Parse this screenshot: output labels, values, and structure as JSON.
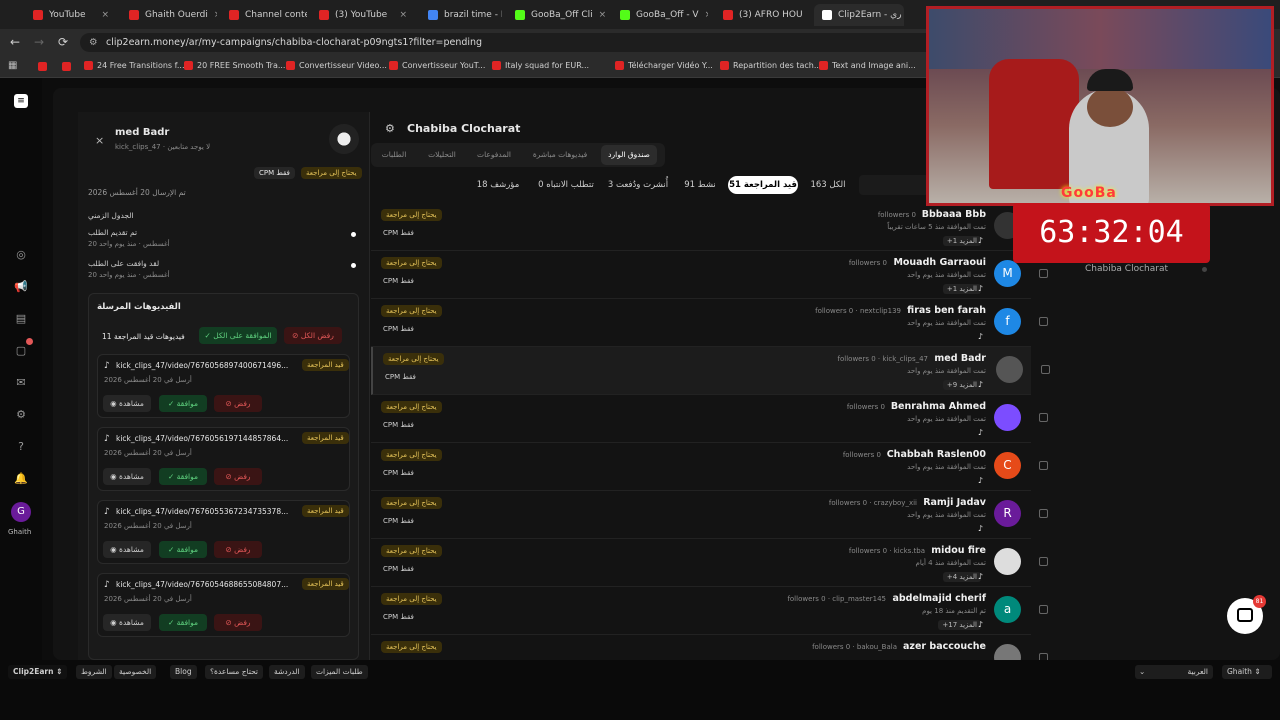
{
  "tabs": [
    {
      "title": "YouTube",
      "color": "#e02424"
    },
    {
      "title": "Ghaith Ouerdi",
      "color": "#e02424"
    },
    {
      "title": "Channel conte",
      "color": "#e02424"
    },
    {
      "title": "(3) YouTube",
      "color": "#e02424"
    },
    {
      "title": "brazil time - R",
      "color": "#4285f4"
    },
    {
      "title": "GooBa_Off Cli",
      "color": "#53fc18"
    },
    {
      "title": "GooBa_Off - V",
      "color": "#53fc18"
    },
    {
      "title": "(3) AFRO HOU",
      "color": "#e02424"
    },
    {
      "title": "Clip2Earn - ري",
      "color": "#ffffff"
    }
  ],
  "url": "clip2earn.money/ar/my-campaigns/chabiba-clocharat-p09ngts1?filter=pending",
  "bookmarks": [
    "24 Free Transitions f...",
    "20 FREE Smooth Tra...",
    "Convertisseur Video...",
    "Convertisseur YouT...",
    "Italy squad for EUR...",
    "Télécharger Vidéo Y...",
    "Repartition des tach...",
    "Text and Image ani..."
  ],
  "rail_user": "Ghaith",
  "rail_user_initial": "G",
  "left_panel": {
    "user": "med Badr",
    "subtitle": "kick_clips_47 · لا يوجد متابعين",
    "close": "×",
    "badge_review": "يحتاج إلى مراجعة",
    "badge_cpm": "CPM فقط",
    "sent_date": "تم الإرسال 20 أغسطس 2026",
    "timeline_title": "الجدول الزمني",
    "timeline": [
      {
        "title": "تم تقديم الطلب",
        "time": "20 أغسطس · منذ يوم واحد"
      },
      {
        "title": "لقد وافقت على الطلب",
        "time": "20 أغسطس · منذ يوم واحد"
      }
    ],
    "videos_title": "الفيديوهات المرسلة",
    "pending_count": "11 فيديوهات قيد المراجعة",
    "approve_all": "الموافقة على الكل",
    "reject_all": "رفض الكل",
    "videos": [
      {
        "url": "kick_clips_47/video/7676056897400671496...",
        "status": "قيد المراجعة",
        "date": "أرسل في 20 أغسطس 2026"
      },
      {
        "url": "kick_clips_47/video/7676056197144857864...",
        "status": "قيد المراجعة",
        "date": "أرسل في 20 أغسطس 2026"
      },
      {
        "url": "kick_clips_47/video/7676055367234735378...",
        "status": "قيد المراجعة",
        "date": "أرسل في 20 أغسطس 2026"
      },
      {
        "url": "kick_clips_47/video/7676054688655084807...",
        "status": "قيد المراجعة",
        "date": "أرسل في 20 أغسطس 2026"
      }
    ],
    "view": "مشاهدة",
    "approve": "موافقة",
    "reject": "رفض"
  },
  "campaign_title": "Chabiba Clocharat",
  "top_tabs": [
    "صندوق الوارد",
    "فيديوهات مباشرة",
    "المدفوعات",
    "التحليلات",
    "الطلبات"
  ],
  "filters": [
    {
      "label": "الكل 163"
    },
    {
      "label": "قيد المراجعة 51",
      "active": true
    },
    {
      "label": "نشط 91"
    },
    {
      "label": "أُنشرت ودُفعت 3"
    },
    {
      "label": "تتطلب الانتباه 0"
    },
    {
      "label": "مؤرشف 18"
    }
  ],
  "rows": [
    {
      "name": "Bbbaaa Bbb",
      "sub": "followers 0",
      "meta": "تمت الموافقة منذ 5 ساعات تقريباً",
      "more": "+1 المزيد",
      "avatar": "",
      "color": "#333"
    },
    {
      "name": "Mouadh Garraoui",
      "sub": "followers 0",
      "meta": "تمت الموافقة منذ يوم واحد",
      "more": "+1 المزيد",
      "avatar": "M",
      "color": "#1e88e5"
    },
    {
      "name": "firas ben farah",
      "sub": "followers 0 · nextclip139",
      "meta": "تمت الموافقة منذ يوم واحد",
      "more": "",
      "avatar": "f",
      "color": "#1e88e5"
    },
    {
      "name": "med Badr",
      "sub": "followers 0 · kick_clips_47",
      "meta": "تمت الموافقة منذ يوم واحد",
      "more": "+9 المزيد",
      "avatar": "",
      "color": "#555"
    },
    {
      "name": "Benrahma Ahmed",
      "sub": "followers 0",
      "meta": "تمت الموافقة منذ يوم واحد",
      "more": "",
      "avatar": "",
      "color": "#7c4dff"
    },
    {
      "name": "Chabbah Raslen00",
      "sub": "followers 0",
      "meta": "تمت الموافقة منذ يوم واحد",
      "more": "",
      "avatar": "C",
      "color": "#e64a19"
    },
    {
      "name": "Ramji Jadav",
      "sub": "followers 0 · crazyboy_xii",
      "meta": "تمت الموافقة منذ يوم واحد",
      "more": "",
      "avatar": "R",
      "color": "#6a1b9a"
    },
    {
      "name": "midou fire",
      "sub": "followers 0 · kicks.tba",
      "meta": "تمت الموافقة منذ 4 أيام",
      "more": "+4 المزيد",
      "avatar": "",
      "color": "#ddd"
    },
    {
      "name": "abdelmajid cherif",
      "sub": "followers 0 · clip_master145",
      "meta": "تم التقديم منذ 18 يوم",
      "more": "+17 المزيد",
      "avatar": "a",
      "color": "#00897b"
    },
    {
      "name": "azer baccouche",
      "sub": "followers 0 · bakou_Bala",
      "meta": "",
      "more": "",
      "avatar": "",
      "color": "#777"
    }
  ],
  "row_badge": "يحتاج إلى مراجعة",
  "row_cpm": "CPM فقط",
  "right_campaign": "Chabiba Clocharat",
  "timer": "63:32:04",
  "overlay_name": "GooBa",
  "bottom_bar": {
    "brand": "Clip2Earn",
    "links": [
      "الشروط",
      "الخصوصية",
      "Blog",
      "تحتاج مساعدة؟",
      "الدردشة",
      "طلبات الميزات"
    ],
    "lang": "العربية",
    "user": "Ghaith"
  },
  "chat_badge": "81"
}
